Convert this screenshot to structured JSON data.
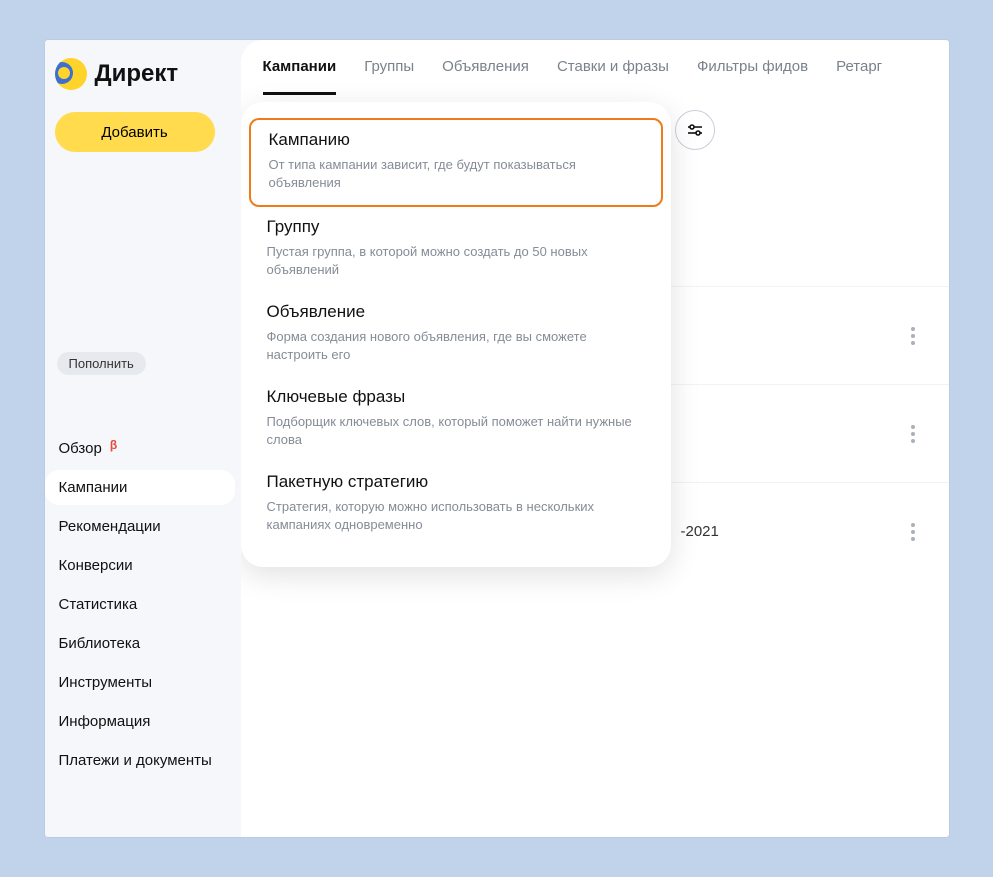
{
  "brand": {
    "title": "Директ"
  },
  "sidebar": {
    "add_label": "Добавить",
    "topup_label": "Пополнить",
    "items": [
      {
        "label": "Обзор",
        "beta": "β"
      },
      {
        "label": "Кампании"
      },
      {
        "label": "Рекомендации"
      },
      {
        "label": "Конверсии"
      },
      {
        "label": "Статистика"
      },
      {
        "label": "Библиотека"
      },
      {
        "label": "Инструменты"
      },
      {
        "label": "Информация"
      },
      {
        "label": "Платежи и документы"
      }
    ]
  },
  "tabs": [
    {
      "label": "Кампании",
      "active": true
    },
    {
      "label": "Группы"
    },
    {
      "label": "Объявления"
    },
    {
      "label": "Ставки и фразы"
    },
    {
      "label": "Фильтры фидов"
    },
    {
      "label": "Ретарг"
    }
  ],
  "popover": {
    "items": [
      {
        "title": "Кампанию",
        "desc": "От типа кампании зависит, где будут показываться объявления",
        "highlight": true
      },
      {
        "title": "Группу",
        "desc": "Пустая группа, в которой можно создать до 50 новых объявлений"
      },
      {
        "title": "Объявление",
        "desc": "Форма создания нового объявления, где вы сможете настроить его"
      },
      {
        "title": "Ключевые фразы",
        "desc": "Подборщик ключевых слов, который поможет найти нужные слова"
      },
      {
        "title": "Пакетную стратегию",
        "desc": "Стратегия, которую можно использовать в нескольких кампаниях одновременно"
      }
    ]
  },
  "visible_date_fragment": "-2021"
}
